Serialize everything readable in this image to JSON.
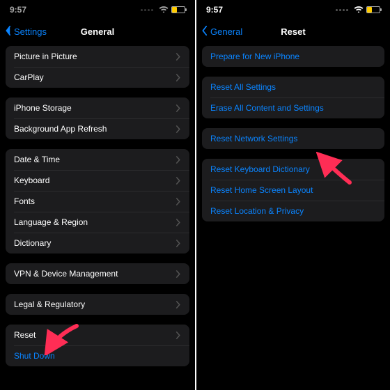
{
  "left": {
    "time": "9:57",
    "back": "Settings",
    "title": "General",
    "groups": [
      {
        "rows": [
          {
            "label": "Picture in Picture",
            "chev": true
          },
          {
            "label": "CarPlay",
            "chev": true
          }
        ]
      },
      {
        "rows": [
          {
            "label": "iPhone Storage",
            "chev": true
          },
          {
            "label": "Background App Refresh",
            "chev": true
          }
        ]
      },
      {
        "rows": [
          {
            "label": "Date & Time",
            "chev": true
          },
          {
            "label": "Keyboard",
            "chev": true
          },
          {
            "label": "Fonts",
            "chev": true
          },
          {
            "label": "Language & Region",
            "chev": true
          },
          {
            "label": "Dictionary",
            "chev": true
          }
        ]
      },
      {
        "rows": [
          {
            "label": "VPN & Device Management",
            "chev": true
          }
        ]
      },
      {
        "rows": [
          {
            "label": "Legal & Regulatory",
            "chev": true
          }
        ]
      },
      {
        "rows": [
          {
            "label": "Reset",
            "chev": true
          },
          {
            "label": "Shut Down",
            "link": true
          }
        ]
      }
    ]
  },
  "right": {
    "time": "9:57",
    "back": "General",
    "title": "Reset",
    "groups": [
      {
        "rows": [
          {
            "label": "Prepare for New iPhone",
            "link": true
          }
        ]
      },
      {
        "rows": [
          {
            "label": "Reset All Settings",
            "link": true
          },
          {
            "label": "Erase All Content and Settings",
            "link": true
          }
        ]
      },
      {
        "rows": [
          {
            "label": "Reset Network Settings",
            "link": true
          }
        ]
      },
      {
        "rows": [
          {
            "label": "Reset Keyboard Dictionary",
            "link": true
          },
          {
            "label": "Reset Home Screen Layout",
            "link": true
          },
          {
            "label": "Reset Location & Privacy",
            "link": true
          }
        ]
      }
    ]
  },
  "arrow_color": "#ff2d55"
}
